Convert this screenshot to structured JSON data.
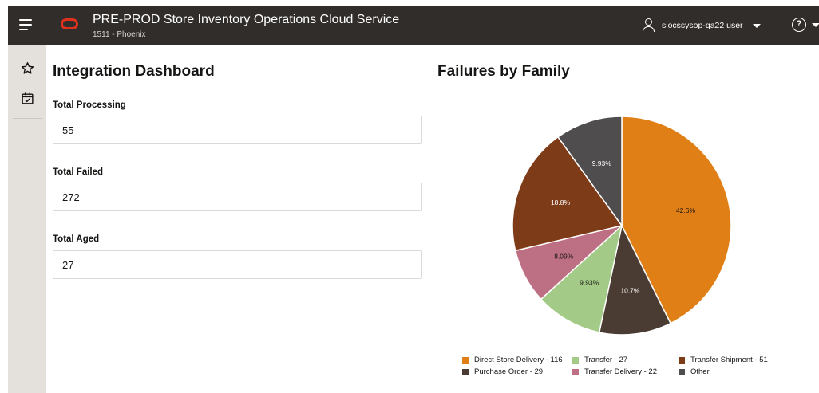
{
  "header": {
    "app_title": "PRE-PROD Store Inventory Operations Cloud Service",
    "store": "1511 - Phoenix",
    "user_name": "siocssysop-qa22 user",
    "help_glyph": "?"
  },
  "sidebar": {
    "items": [
      {
        "name": "favorites",
        "icon": "star-icon"
      },
      {
        "name": "tasks",
        "icon": "calendar-check-icon"
      }
    ]
  },
  "dashboard": {
    "title": "Integration Dashboard",
    "fields": [
      {
        "label": "Total Processing",
        "value": "55"
      },
      {
        "label": "Total Failed",
        "value": "272"
      },
      {
        "label": "Total Aged",
        "value": "27"
      }
    ]
  },
  "chart_data": {
    "type": "pie",
    "title": "Failures by Family",
    "slices": [
      {
        "name": "Direct Store Delivery",
        "value": 116,
        "label": "42.6%",
        "legend": "Direct Store Delivery - 116",
        "color": "#e07f16"
      },
      {
        "name": "Purchase Order",
        "value": 29,
        "label": "10.7%",
        "legend": "Purchase Order - 29",
        "color": "#4a3c32"
      },
      {
        "name": "Transfer",
        "value": 27,
        "label": "9.93%",
        "legend": "Transfer - 27",
        "color": "#a3ca86"
      },
      {
        "name": "Transfer Delivery",
        "value": 22,
        "label": "8.09%",
        "legend": "Transfer Delivery - 22",
        "color": "#bd6f84"
      },
      {
        "name": "Transfer Shipment",
        "value": 51,
        "label": "18.8%",
        "legend": "Transfer Shipment - 51",
        "color": "#7e3b18"
      },
      {
        "name": "Other",
        "value": 27,
        "label": "9.93%",
        "legend": "Other",
        "color": "#4f4d4d"
      }
    ],
    "legend_order": [
      "Direct Store Delivery",
      "Transfer",
      "Transfer Shipment",
      "Purchase Order",
      "Transfer Delivery",
      "Other"
    ],
    "legend_position": "bottom"
  }
}
